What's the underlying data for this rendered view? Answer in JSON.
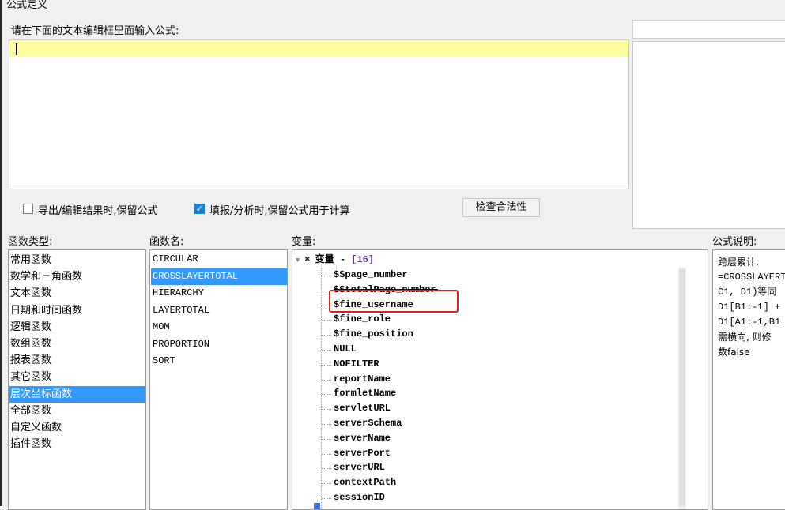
{
  "window": {
    "title": "公式定义"
  },
  "editor": {
    "prompt": "请在下面的文本编辑框里面输入公式:",
    "value": ""
  },
  "options": {
    "keep_formula_export": {
      "label": "导出/编辑结果时,保留公式",
      "checked": false
    },
    "keep_formula_fill": {
      "label": "填报/分析时,保留公式用于计算",
      "checked": true
    },
    "check_button": "检查合法性"
  },
  "columns": {
    "types": "函数类型:",
    "names": "函数名:",
    "vars": "变量:",
    "desc": "公式说明:"
  },
  "function_types": [
    "常用函数",
    "数学和三角函数",
    "文本函数",
    "日期和时间函数",
    "逻辑函数",
    "数组函数",
    "报表函数",
    "其它函数",
    "层次坐标函数",
    "全部函数",
    "自定义函数",
    "插件函数"
  ],
  "selected_type": "层次坐标函数",
  "function_names": [
    "CIRCULAR",
    "CROSSLAYERTOTAL",
    "HIERARCHY",
    "LAYERTOTAL",
    "MOM",
    "PROPORTION",
    "SORT"
  ],
  "selected_function": "CROSSLAYERTOTAL",
  "variables": {
    "root_label": "变量 - ",
    "root_count": "[16]",
    "items": [
      "$$page_number",
      "$$totalPage_number",
      "$fine_username",
      "$fine_role",
      "$fine_position",
      "NULL",
      "NOFILTER",
      "reportName",
      "formletName",
      "servletURL",
      "serverSchema",
      "serverName",
      "serverPort",
      "serverURL",
      "contextPath",
      "sessionID"
    ],
    "highlighted": "$fine_username"
  },
  "description": {
    "lines": [
      "跨层累计,",
      "=CROSSLAYERT",
      "C1, D1)等同",
      "D1[B1:-1] +",
      "D1[A1:-1,B1",
      "需横向, 则修",
      "数false"
    ]
  },
  "colors": {
    "selection": "#3399ff",
    "editor_line": "#ffffa0",
    "highlight_box": "#e0201d",
    "check": "#1d7fd8"
  }
}
